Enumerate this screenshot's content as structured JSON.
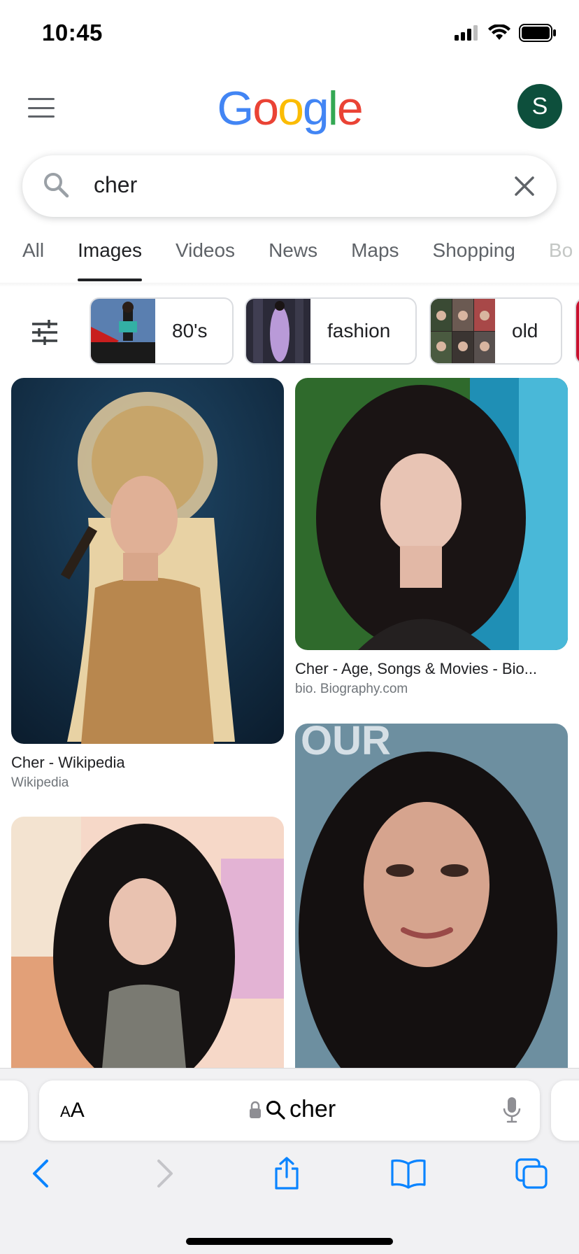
{
  "status": {
    "time": "10:45"
  },
  "header": {
    "logo": [
      "G",
      "o",
      "o",
      "g",
      "l",
      "e"
    ],
    "avatar_letter": "S"
  },
  "search": {
    "query": "cher"
  },
  "tabs": [
    "All",
    "Images",
    "Videos",
    "News",
    "Maps",
    "Shopping",
    "Bo"
  ],
  "active_tab": "Images",
  "chips": [
    {
      "label": "80's"
    },
    {
      "label": "fashion"
    },
    {
      "label": "old"
    }
  ],
  "results": [
    {
      "title": "Cher - Wikipedia",
      "source": "Wikipedia"
    },
    {
      "title": "Cher - Age, Songs & Movies - Bio...",
      "source": "bio. Biography.com"
    },
    {
      "title": "",
      "source": ""
    },
    {
      "title": "",
      "source": ""
    }
  ],
  "safari": {
    "aa_label_small": "A",
    "aa_label_large": "A",
    "url_text": "cher"
  },
  "colors": {
    "avatar_bg": "#0d4f3c",
    "google_blue": "#4285F4",
    "google_red": "#EA4335",
    "google_yellow": "#FBBC05",
    "google_green": "#34A853",
    "ios_blue": "#0a84ff"
  }
}
